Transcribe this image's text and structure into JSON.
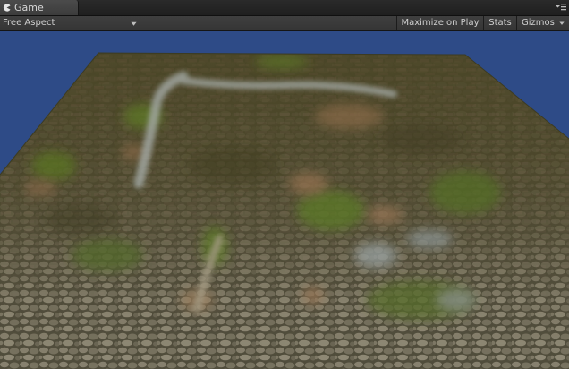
{
  "window": {
    "tab_title": "Game",
    "tab_icon": "pacman-icon",
    "tab_menu_icon": "tab-menu-icon"
  },
  "toolbar": {
    "aspect_value": "Free Aspect",
    "maximize_label": "Maximize on Play",
    "stats_label": "Stats",
    "gizmos_label": "Gizmos",
    "dropdown_icon": "chevron-down-icon"
  },
  "viewport": {
    "sky_color": "#2e4b87",
    "terrain_colors": {
      "grass": "#4a4a1e",
      "dirt": "#5d4a2f",
      "stone": "#7a7566",
      "path": "#9aa09a"
    }
  }
}
